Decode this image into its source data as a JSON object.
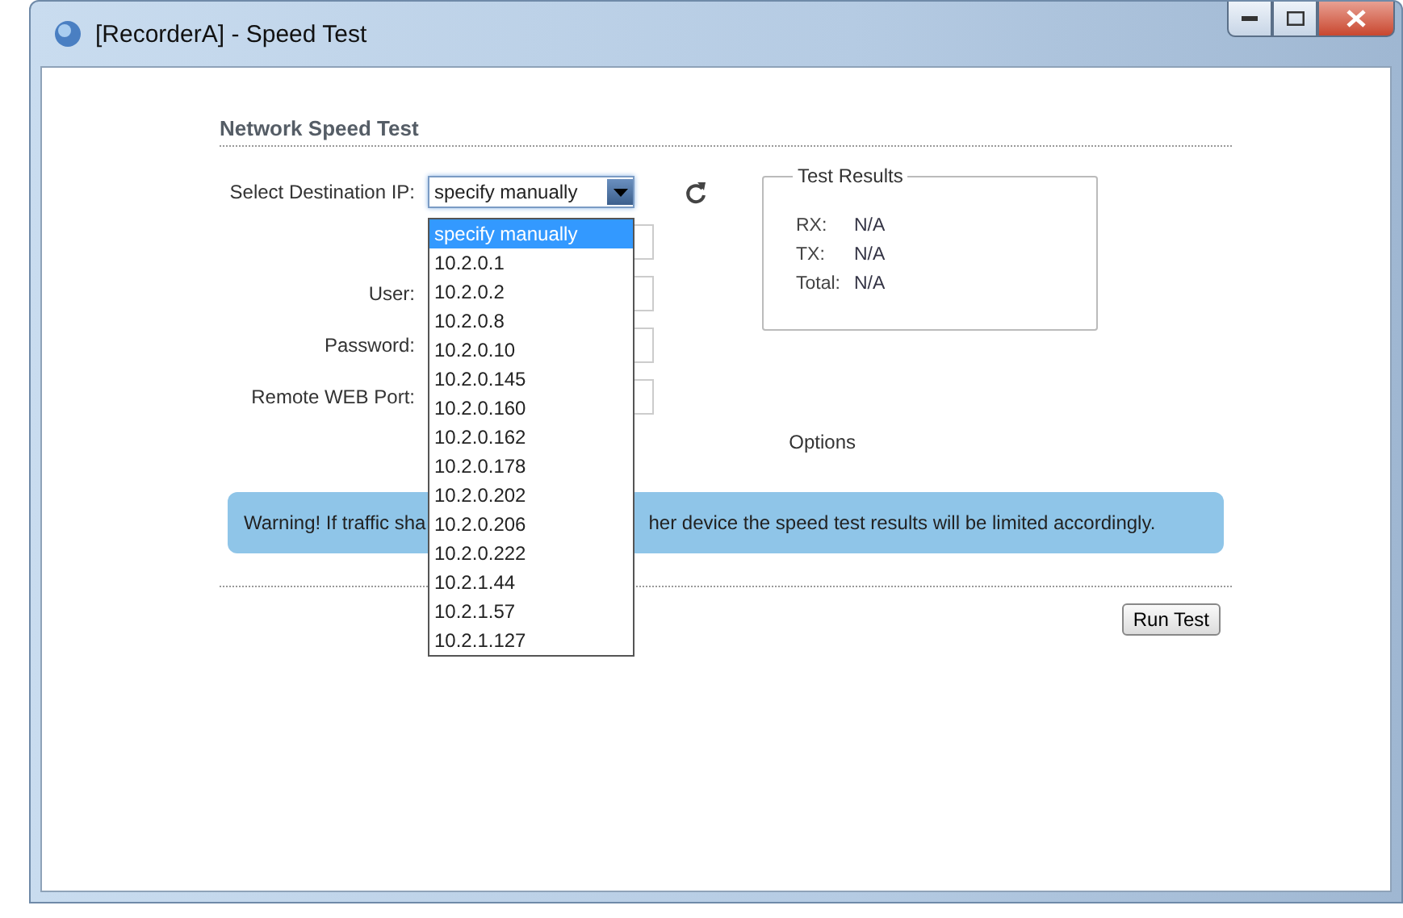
{
  "window": {
    "title": "[RecorderA] - Speed Test"
  },
  "section": {
    "title": "Network Speed Test"
  },
  "destination": {
    "label": "Select Destination IP:",
    "value": "specify manually",
    "expanded": true,
    "options": [
      {
        "label": "specify manually",
        "selected": true
      },
      {
        "label": "10.2.0.1",
        "selected": false
      },
      {
        "label": "10.2.0.2",
        "selected": false
      },
      {
        "label": "10.2.0.8",
        "selected": false
      },
      {
        "label": "10.2.0.10",
        "selected": false
      },
      {
        "label": "10.2.0.145",
        "selected": false
      },
      {
        "label": "10.2.0.160",
        "selected": false
      },
      {
        "label": "10.2.0.162",
        "selected": false
      },
      {
        "label": "10.2.0.178",
        "selected": false
      },
      {
        "label": "10.2.0.202",
        "selected": false
      },
      {
        "label": "10.2.0.206",
        "selected": false
      },
      {
        "label": "10.2.0.222",
        "selected": false
      },
      {
        "label": "10.2.1.44",
        "selected": false
      },
      {
        "label": "10.2.1.57",
        "selected": false
      },
      {
        "label": "10.2.1.127",
        "selected": false
      }
    ]
  },
  "fields": [
    {
      "label": "User:"
    },
    {
      "label": "Password:"
    },
    {
      "label": "Remote WEB Port:"
    }
  ],
  "options_label": "Options",
  "test_results": {
    "title": "Test Results",
    "rows": [
      {
        "label": "RX:",
        "value": "N/A"
      },
      {
        "label": "TX:",
        "value": "N/A"
      },
      {
        "label": "Total:",
        "value": "N/A"
      }
    ]
  },
  "warning": {
    "before": "Warning! If traffic sha",
    "after": "her device the speed test results will be limited accordingly."
  },
  "buttons": [
    "Run Test"
  ]
}
